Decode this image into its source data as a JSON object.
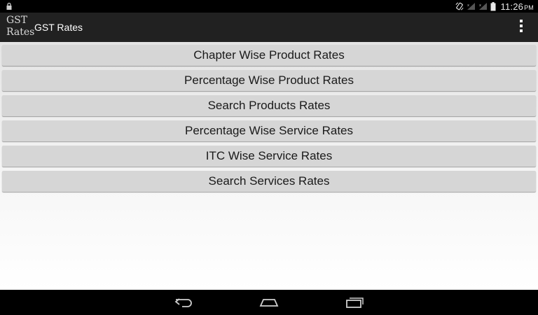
{
  "status_bar": {
    "time": "11:26",
    "ampm": "PM",
    "icons": [
      "lock-icon",
      "screen-rotation-icon",
      "signal-icon",
      "signal-icon",
      "battery-icon"
    ]
  },
  "action_bar": {
    "logo_line1": "GST",
    "logo_line2": "Rates",
    "title": "GST Rates",
    "menu_icon": "overflow-menu-icon"
  },
  "menu": {
    "items": [
      {
        "label": "Chapter Wise Product Rates"
      },
      {
        "label": "Percentage Wise Product Rates"
      },
      {
        "label": "Search Products Rates"
      },
      {
        "label": "Percentage Wise Service Rates"
      },
      {
        "label": "ITC Wise Service Rates"
      },
      {
        "label": "Search Services Rates"
      }
    ]
  },
  "nav_bar": {
    "icons": [
      "back-icon",
      "home-icon",
      "recents-icon"
    ]
  },
  "colors": {
    "status_bar_bg": "#000000",
    "action_bar_bg": "#212121",
    "button_bg": "#d6d6d6",
    "content_bg_top": "#e4e4e4",
    "content_bg_bottom": "#ffffff"
  }
}
